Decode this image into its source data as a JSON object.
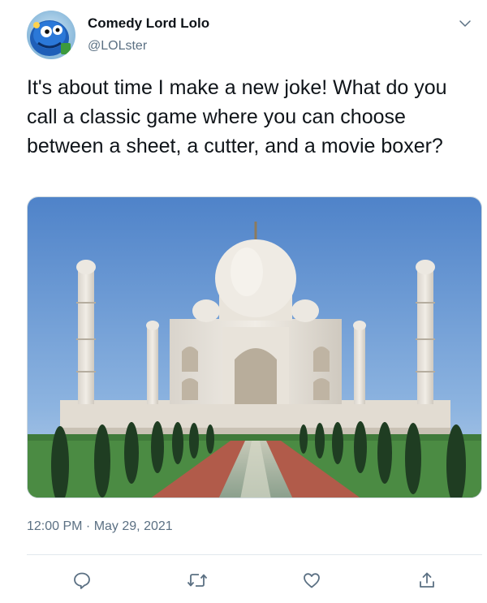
{
  "author": {
    "display_name": "Comedy Lord Lolo",
    "handle": "@LOLster",
    "avatar_icon": "cartoon-character-avatar"
  },
  "tweet": {
    "text": "It's about time I make a new joke! What do you call a classic game where you can choose between a sheet, a cutter, and a movie boxer?",
    "timestamp": "12:00 PM · May 29, 2021",
    "media_icon": "taj-mahal-photo"
  },
  "actions": {
    "reply_icon": "reply-icon",
    "retweet_icon": "retweet-icon",
    "like_icon": "heart-icon",
    "share_icon": "share-icon"
  },
  "colors": {
    "text_primary": "#0f1419",
    "text_secondary": "#5b7083",
    "divider": "#e1e8ed",
    "icon_gray": "#5b7083"
  }
}
